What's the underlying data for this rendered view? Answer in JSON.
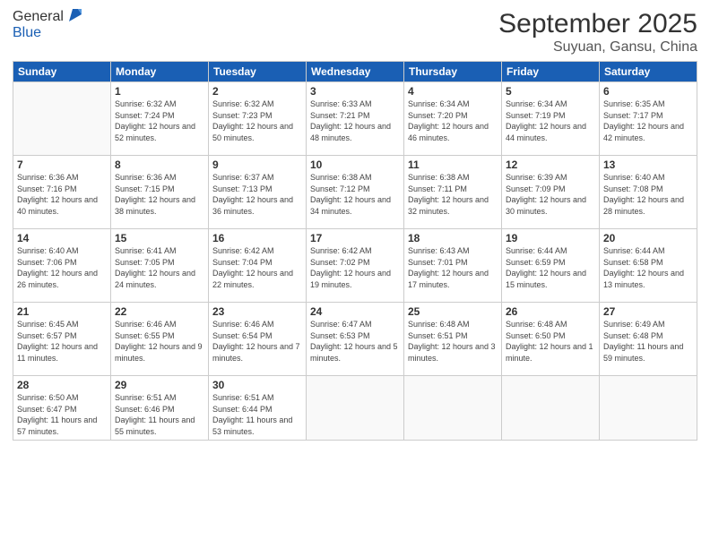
{
  "logo": {
    "general": "General",
    "blue": "Blue"
  },
  "header": {
    "month": "September 2025",
    "location": "Suyuan, Gansu, China"
  },
  "weekdays": [
    "Sunday",
    "Monday",
    "Tuesday",
    "Wednesday",
    "Thursday",
    "Friday",
    "Saturday"
  ],
  "weeks": [
    [
      {
        "day": "",
        "sunrise": "",
        "sunset": "",
        "daylight": ""
      },
      {
        "day": "1",
        "sunrise": "Sunrise: 6:32 AM",
        "sunset": "Sunset: 7:24 PM",
        "daylight": "Daylight: 12 hours and 52 minutes."
      },
      {
        "day": "2",
        "sunrise": "Sunrise: 6:32 AM",
        "sunset": "Sunset: 7:23 PM",
        "daylight": "Daylight: 12 hours and 50 minutes."
      },
      {
        "day": "3",
        "sunrise": "Sunrise: 6:33 AM",
        "sunset": "Sunset: 7:21 PM",
        "daylight": "Daylight: 12 hours and 48 minutes."
      },
      {
        "day": "4",
        "sunrise": "Sunrise: 6:34 AM",
        "sunset": "Sunset: 7:20 PM",
        "daylight": "Daylight: 12 hours and 46 minutes."
      },
      {
        "day": "5",
        "sunrise": "Sunrise: 6:34 AM",
        "sunset": "Sunset: 7:19 PM",
        "daylight": "Daylight: 12 hours and 44 minutes."
      },
      {
        "day": "6",
        "sunrise": "Sunrise: 6:35 AM",
        "sunset": "Sunset: 7:17 PM",
        "daylight": "Daylight: 12 hours and 42 minutes."
      }
    ],
    [
      {
        "day": "7",
        "sunrise": "Sunrise: 6:36 AM",
        "sunset": "Sunset: 7:16 PM",
        "daylight": "Daylight: 12 hours and 40 minutes."
      },
      {
        "day": "8",
        "sunrise": "Sunrise: 6:36 AM",
        "sunset": "Sunset: 7:15 PM",
        "daylight": "Daylight: 12 hours and 38 minutes."
      },
      {
        "day": "9",
        "sunrise": "Sunrise: 6:37 AM",
        "sunset": "Sunset: 7:13 PM",
        "daylight": "Daylight: 12 hours and 36 minutes."
      },
      {
        "day": "10",
        "sunrise": "Sunrise: 6:38 AM",
        "sunset": "Sunset: 7:12 PM",
        "daylight": "Daylight: 12 hours and 34 minutes."
      },
      {
        "day": "11",
        "sunrise": "Sunrise: 6:38 AM",
        "sunset": "Sunset: 7:11 PM",
        "daylight": "Daylight: 12 hours and 32 minutes."
      },
      {
        "day": "12",
        "sunrise": "Sunrise: 6:39 AM",
        "sunset": "Sunset: 7:09 PM",
        "daylight": "Daylight: 12 hours and 30 minutes."
      },
      {
        "day": "13",
        "sunrise": "Sunrise: 6:40 AM",
        "sunset": "Sunset: 7:08 PM",
        "daylight": "Daylight: 12 hours and 28 minutes."
      }
    ],
    [
      {
        "day": "14",
        "sunrise": "Sunrise: 6:40 AM",
        "sunset": "Sunset: 7:06 PM",
        "daylight": "Daylight: 12 hours and 26 minutes."
      },
      {
        "day": "15",
        "sunrise": "Sunrise: 6:41 AM",
        "sunset": "Sunset: 7:05 PM",
        "daylight": "Daylight: 12 hours and 24 minutes."
      },
      {
        "day": "16",
        "sunrise": "Sunrise: 6:42 AM",
        "sunset": "Sunset: 7:04 PM",
        "daylight": "Daylight: 12 hours and 22 minutes."
      },
      {
        "day": "17",
        "sunrise": "Sunrise: 6:42 AM",
        "sunset": "Sunset: 7:02 PM",
        "daylight": "Daylight: 12 hours and 19 minutes."
      },
      {
        "day": "18",
        "sunrise": "Sunrise: 6:43 AM",
        "sunset": "Sunset: 7:01 PM",
        "daylight": "Daylight: 12 hours and 17 minutes."
      },
      {
        "day": "19",
        "sunrise": "Sunrise: 6:44 AM",
        "sunset": "Sunset: 6:59 PM",
        "daylight": "Daylight: 12 hours and 15 minutes."
      },
      {
        "day": "20",
        "sunrise": "Sunrise: 6:44 AM",
        "sunset": "Sunset: 6:58 PM",
        "daylight": "Daylight: 12 hours and 13 minutes."
      }
    ],
    [
      {
        "day": "21",
        "sunrise": "Sunrise: 6:45 AM",
        "sunset": "Sunset: 6:57 PM",
        "daylight": "Daylight: 12 hours and 11 minutes."
      },
      {
        "day": "22",
        "sunrise": "Sunrise: 6:46 AM",
        "sunset": "Sunset: 6:55 PM",
        "daylight": "Daylight: 12 hours and 9 minutes."
      },
      {
        "day": "23",
        "sunrise": "Sunrise: 6:46 AM",
        "sunset": "Sunset: 6:54 PM",
        "daylight": "Daylight: 12 hours and 7 minutes."
      },
      {
        "day": "24",
        "sunrise": "Sunrise: 6:47 AM",
        "sunset": "Sunset: 6:53 PM",
        "daylight": "Daylight: 12 hours and 5 minutes."
      },
      {
        "day": "25",
        "sunrise": "Sunrise: 6:48 AM",
        "sunset": "Sunset: 6:51 PM",
        "daylight": "Daylight: 12 hours and 3 minutes."
      },
      {
        "day": "26",
        "sunrise": "Sunrise: 6:48 AM",
        "sunset": "Sunset: 6:50 PM",
        "daylight": "Daylight: 12 hours and 1 minute."
      },
      {
        "day": "27",
        "sunrise": "Sunrise: 6:49 AM",
        "sunset": "Sunset: 6:48 PM",
        "daylight": "Daylight: 11 hours and 59 minutes."
      }
    ],
    [
      {
        "day": "28",
        "sunrise": "Sunrise: 6:50 AM",
        "sunset": "Sunset: 6:47 PM",
        "daylight": "Daylight: 11 hours and 57 minutes."
      },
      {
        "day": "29",
        "sunrise": "Sunrise: 6:51 AM",
        "sunset": "Sunset: 6:46 PM",
        "daylight": "Daylight: 11 hours and 55 minutes."
      },
      {
        "day": "30",
        "sunrise": "Sunrise: 6:51 AM",
        "sunset": "Sunset: 6:44 PM",
        "daylight": "Daylight: 11 hours and 53 minutes."
      },
      {
        "day": "",
        "sunrise": "",
        "sunset": "",
        "daylight": ""
      },
      {
        "day": "",
        "sunrise": "",
        "sunset": "",
        "daylight": ""
      },
      {
        "day": "",
        "sunrise": "",
        "sunset": "",
        "daylight": ""
      },
      {
        "day": "",
        "sunrise": "",
        "sunset": "",
        "daylight": ""
      }
    ]
  ]
}
